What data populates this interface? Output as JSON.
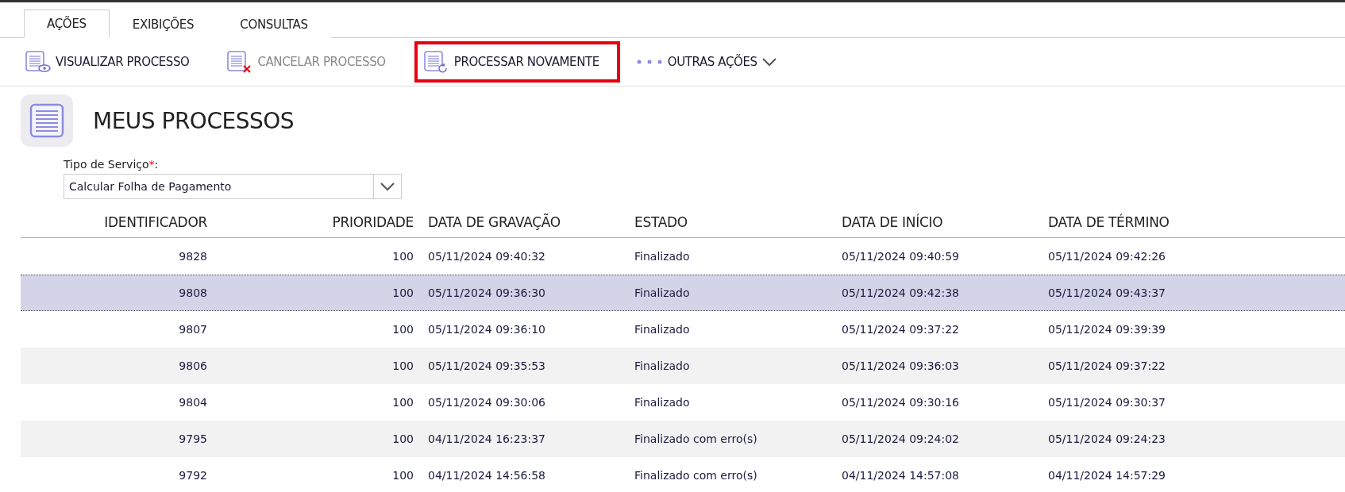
{
  "tabs": [
    {
      "label": "AÇÕES",
      "selected": true
    },
    {
      "label": "EXIBIÇÕES",
      "selected": false
    },
    {
      "label": "CONSULTAS",
      "selected": false
    }
  ],
  "toolbar": [
    {
      "kind": "view",
      "label": "VISUALIZAR PROCESSO",
      "disabled": false,
      "highlighted": false
    },
    {
      "kind": "cancel",
      "label": "CANCELAR PROCESSO",
      "disabled": true,
      "highlighted": false
    },
    {
      "kind": "reprocess",
      "label": "PROCESSAR NOVAMENTE",
      "disabled": false,
      "highlighted": true
    },
    {
      "kind": "more",
      "label": "OUTRAS AÇÕES",
      "disabled": false,
      "highlighted": false
    }
  ],
  "page_title": "MEUS PROCESSOS",
  "service_field": {
    "label": "Tipo de Serviço",
    "required_mark": "*",
    "suffix": ":",
    "value": "Calcular Folha de Pagamento"
  },
  "table": {
    "columns": [
      "IDENTIFICADOR",
      "PRIORIDADE",
      "DATA DE GRAVAÇÃO",
      "ESTADO",
      "DATA DE INÍCIO",
      "DATA DE TÉRMINO"
    ],
    "rows": [
      {
        "selected": false,
        "cells": [
          "9828",
          "100",
          "05/11/2024 09:40:32",
          "Finalizado",
          "05/11/2024 09:40:59",
          "05/11/2024 09:42:26"
        ]
      },
      {
        "selected": true,
        "cells": [
          "9808",
          "100",
          "05/11/2024 09:36:30",
          "Finalizado",
          "05/11/2024 09:42:38",
          "05/11/2024 09:43:37"
        ]
      },
      {
        "selected": false,
        "cells": [
          "9807",
          "100",
          "05/11/2024 09:36:10",
          "Finalizado",
          "05/11/2024 09:37:22",
          "05/11/2024 09:39:39"
        ]
      },
      {
        "selected": false,
        "cells": [
          "9806",
          "100",
          "05/11/2024 09:35:53",
          "Finalizado",
          "05/11/2024 09:36:03",
          "05/11/2024 09:37:22"
        ]
      },
      {
        "selected": false,
        "cells": [
          "9804",
          "100",
          "05/11/2024 09:30:06",
          "Finalizado",
          "05/11/2024 09:30:16",
          "05/11/2024 09:30:37"
        ]
      },
      {
        "selected": false,
        "cells": [
          "9795",
          "100",
          "04/11/2024 16:23:37",
          "Finalizado com erro(s)",
          "05/11/2024 09:24:02",
          "05/11/2024 09:24:23"
        ]
      },
      {
        "selected": false,
        "cells": [
          "9792",
          "100",
          "04/11/2024 14:56:58",
          "Finalizado com erro(s)",
          "04/11/2024 14:57:08",
          "04/11/2024 14:57:29"
        ]
      }
    ]
  }
}
